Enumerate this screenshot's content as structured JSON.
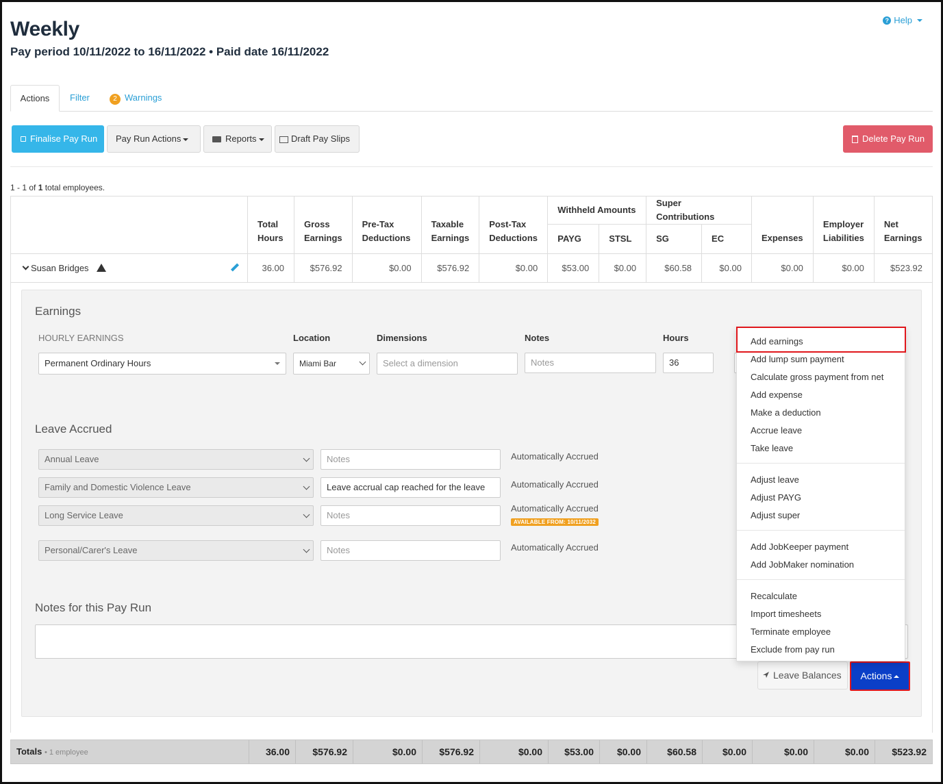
{
  "header": {
    "title": "Weekly",
    "subtitle": "Pay period 10/11/2022 to 16/11/2022 • Paid date 16/11/2022",
    "help": "Help"
  },
  "tabs": [
    {
      "label": "Actions"
    },
    {
      "label": "Filter"
    },
    {
      "label": "Warnings",
      "badge": "2"
    }
  ],
  "toolbar": {
    "finalise": "Finalise Pay Run",
    "pay_run_actions": "Pay Run Actions",
    "reports": "Reports",
    "draft_pay_slips": "Draft Pay Slips",
    "delete": "Delete Pay Run"
  },
  "summary": {
    "prefix": "1 - 1 of ",
    "total": "1",
    "suffix": " total employees."
  },
  "table": {
    "col_total_hours": [
      "Total",
      "Hours"
    ],
    "col_gross": [
      "Gross",
      "Earnings"
    ],
    "col_pretax": [
      "Pre-Tax",
      "Deductions"
    ],
    "col_taxable": [
      "Taxable",
      "Earnings"
    ],
    "col_posttax": [
      "Post-Tax",
      "Deductions"
    ],
    "group_withheld": "Withheld Amounts",
    "group_super": "Super Contributions",
    "col_payg": "PAYG",
    "col_stsl": "STSL",
    "col_sg": "SG",
    "col_ec": "EC",
    "col_expenses": "Expenses",
    "col_employer": [
      "Employer",
      "Liabilities"
    ],
    "col_net": [
      "Net",
      "Earnings"
    ],
    "row": {
      "employee": "Susan Bridges",
      "total_hours": "36.00",
      "gross": "$576.92",
      "pretax": "$0.00",
      "taxable": "$576.92",
      "posttax": "$0.00",
      "payg": "$53.00",
      "stsl": "$0.00",
      "sg": "$60.58",
      "ec": "$0.00",
      "expenses": "$0.00",
      "employer": "$0.00",
      "net": "$523.92"
    }
  },
  "earnings": {
    "title": "Earnings",
    "hourly_label": "HOURLY EARNINGS",
    "location_label": "Location",
    "dimensions_label": "Dimensions",
    "notes_label": "Notes",
    "hours_label": "Hours",
    "pay_category": "Permanent Ordinary Hours",
    "location": "Miami Bar",
    "dimension_placeholder": "Select a dimension",
    "notes_placeholder": "Notes",
    "hours": "36"
  },
  "leave": {
    "title": "Leave Accrued",
    "items": [
      {
        "type": "Annual Leave",
        "notes": "",
        "notes_placeholder": "Notes",
        "status": "Automatically Accrued"
      },
      {
        "type": "Family and Domestic Violence Leave",
        "notes": "Leave accrual cap reached for the leave",
        "notes_placeholder": "Notes",
        "status": "Automatically Accrued"
      },
      {
        "type": "Long Service Leave",
        "notes": "",
        "notes_placeholder": "Notes",
        "status": "Automatically Accrued",
        "badge": "AVAILABLE FROM: 10/11/2032"
      },
      {
        "type": "Personal/Carer's Leave",
        "notes": "",
        "notes_placeholder": "Notes",
        "status": "Automatically Accrued"
      }
    ]
  },
  "notes_section": {
    "title": "Notes for this Pay Run"
  },
  "panel_buttons": {
    "leave_balances": "Leave Balances",
    "actions": "Actions"
  },
  "actions_menu": {
    "group1": [
      "Add earnings",
      "Add lump sum payment",
      "Calculate gross payment from net",
      "Add expense",
      "Make a deduction",
      "Accrue leave",
      "Take leave"
    ],
    "group2": [
      "Adjust leave",
      "Adjust PAYG",
      "Adjust super"
    ],
    "group3": [
      "Add JobKeeper payment",
      "Add JobMaker nomination"
    ],
    "group4": [
      "Recalculate",
      "Import timesheets",
      "Terminate employee",
      "Exclude from pay run"
    ]
  },
  "totals": {
    "label": "Totals",
    "sub": "• 1 employee",
    "total_hours": "36.00",
    "gross": "$576.92",
    "pretax": "$0.00",
    "taxable": "$576.92",
    "posttax": "$0.00",
    "payg": "$53.00",
    "stsl": "$0.00",
    "sg": "$60.58",
    "ec": "$0.00",
    "expenses": "$0.00",
    "employer": "$0.00",
    "net": "$523.92"
  },
  "colors": {
    "primary": "#35b6e9",
    "danger": "#e15b6a",
    "link": "#2a9fd6",
    "warning": "#f0a020",
    "highlight": "#e0161b",
    "actions_btn": "#0b3fc7"
  }
}
